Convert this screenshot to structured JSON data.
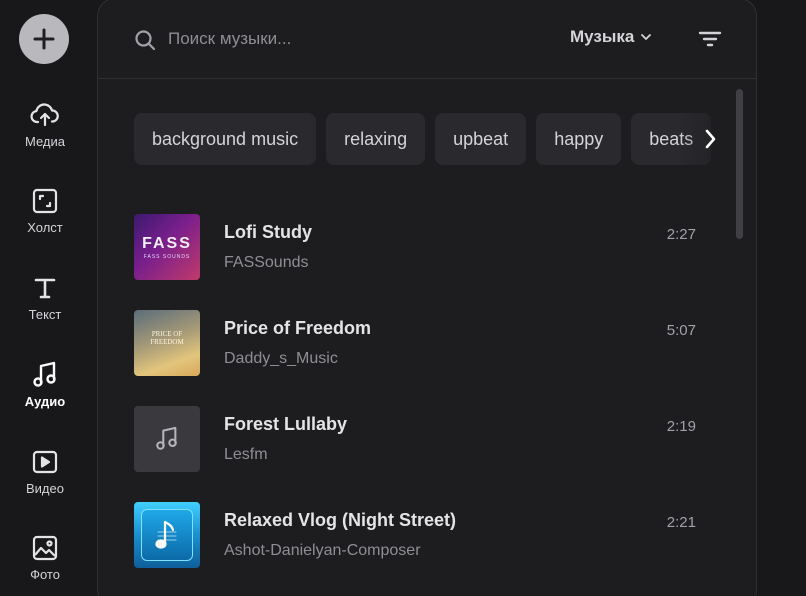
{
  "sidebar": {
    "add_label": "+",
    "items": [
      {
        "label": "Медиа",
        "icon": "upload-cloud-icon",
        "active": false
      },
      {
        "label": "Холст",
        "icon": "canvas-resize-icon",
        "active": false
      },
      {
        "label": "Текст",
        "icon": "text-icon",
        "active": false
      },
      {
        "label": "Аудио",
        "icon": "music-note-icon",
        "active": true
      },
      {
        "label": "Видео",
        "icon": "video-play-icon",
        "active": false
      },
      {
        "label": "Фото",
        "icon": "image-icon",
        "active": false
      }
    ]
  },
  "search": {
    "placeholder": "Поиск музыки...",
    "category": "Музыка"
  },
  "chips": [
    "background music",
    "relaxing",
    "upbeat",
    "happy",
    "beats"
  ],
  "tracks": [
    {
      "title": "Lofi Study",
      "artist": "FASSounds",
      "duration": "2:27",
      "thumb_text": "FASS",
      "thumb_subtext": "FASS SOUNDS"
    },
    {
      "title": "Price of Freedom",
      "artist": "Daddy_s_Music",
      "duration": "5:07",
      "thumb_text": "PRICE OF FREEDOM"
    },
    {
      "title": "Forest Lullaby",
      "artist": "Lesfm",
      "duration": "2:19"
    },
    {
      "title": "Relaxed Vlog (Night Street)",
      "artist": "Ashot-Danielyan-Composer",
      "duration": "2:21"
    }
  ],
  "colors": {
    "background": "#18181b",
    "panel": "#1d1d20",
    "chip": "#2a2a2e",
    "muted_text": "#8e8e94",
    "add_button": "#b9b9bd"
  }
}
